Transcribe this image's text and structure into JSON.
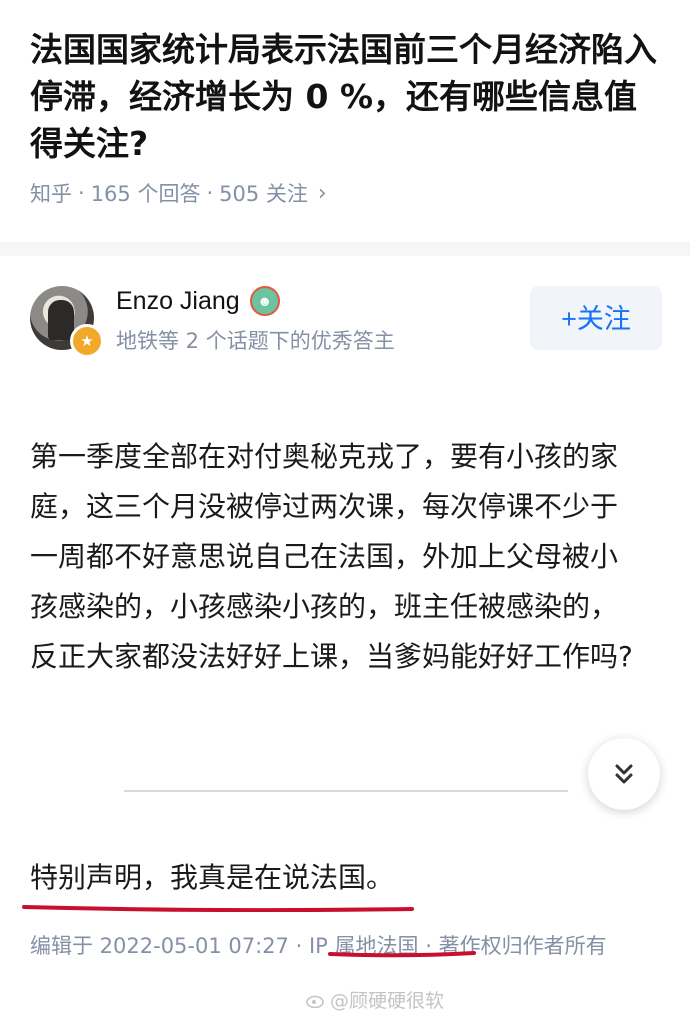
{
  "question": {
    "title": "法国国家统计局表示法国前三个月经济陷入停滞，经济增长为 0 %，还有哪些信息值得关注?",
    "source": "知乎",
    "answers": "165 个回答",
    "follows": "505 关注",
    "separator": "·",
    "chevron": "›"
  },
  "author": {
    "name": "Enzo Jiang",
    "description": "地铁等 2 个话题下的优秀答主",
    "follow_label": "+关注",
    "badge_icon": "medal-icon",
    "name_badge_icon": "emoji-badge-icon"
  },
  "answer": {
    "body": "第一季度全部在对付奥秘克戎了，要有小孩的家庭，这三个月没被停过两次课，每次停课不少于一周都不好意思说自己在法国，外加上父母被小孩感染的，小孩感染小孩的，班主任被感染的，反正大家都没法好好上课，当爹妈能好好工作吗?",
    "expand_icon": "chevron-double-down-icon",
    "statement": "特别声明，我真是在说法国。",
    "edited": "编辑于 2022-05-01 07:27",
    "ip": "IP 属地法国",
    "copyright": "著作权归作者所有",
    "dot": "·"
  },
  "watermark": {
    "text": "@顾硬硬很软"
  },
  "colors": {
    "accent": "#1772f6",
    "muted": "#8590a6",
    "underline_red": "#c8102e"
  }
}
